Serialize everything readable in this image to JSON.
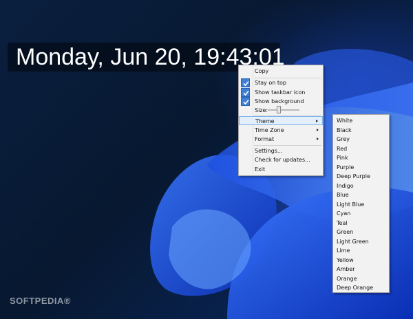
{
  "clock": {
    "text": "Monday, Jun 20, 19:43:01"
  },
  "context_menu": {
    "copy": "Copy",
    "stay_on_top": "Stay on top",
    "show_taskbar_icon": "Show taskbar icon",
    "show_background": "Show background",
    "size_label": "Size:",
    "size_slider_value": 0.3,
    "theme": "Theme",
    "time_zone": "Time Zone",
    "format": "Format",
    "settings": "Settings...",
    "check_updates": "Check for updates...",
    "exit": "Exit"
  },
  "theme_menu": {
    "items": [
      "White",
      "Black",
      "Grey",
      "Red",
      "Pink",
      "Purple",
      "Deep Purple",
      "Indigo",
      "Blue",
      "Light Blue",
      "Cyan",
      "Teal",
      "Green",
      "Light Green",
      "Lime",
      "Yellow",
      "Amber",
      "Orange",
      "Deep Orange"
    ]
  },
  "watermark": "SOFTPEDIA®",
  "colors": {
    "accent": "#3f7fd6",
    "highlight": "#e3effc"
  }
}
